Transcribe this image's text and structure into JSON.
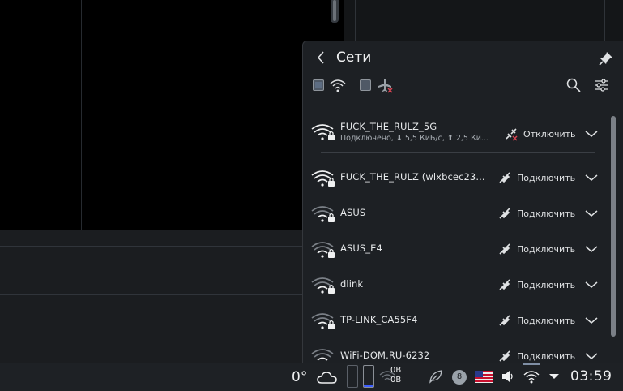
{
  "popup": {
    "title": "Сети",
    "networks": [
      {
        "ssid": "FUCK_THE_RULZ_5G",
        "status": "Подключено, ⬇ 5,5 КиБ/с, ⬆ 2,5 Ки...",
        "action": "Отключить",
        "connected": true
      },
      {
        "ssid": "FUCK_THE_RULZ (wlxbcec23...",
        "action": "Подключить"
      },
      {
        "ssid": "ASUS",
        "action": "Подключить"
      },
      {
        "ssid": "ASUS_E4",
        "action": "Подключить"
      },
      {
        "ssid": "dlink",
        "action": "Подключить"
      },
      {
        "ssid": "TP-LINK_CA55F4",
        "action": "Подключить"
      },
      {
        "ssid": "WiFi-DOM.RU-6232",
        "action": "Подключить"
      }
    ]
  },
  "taskbar": {
    "temperature": "0°",
    "net_down": "0B",
    "net_up": "0B",
    "notifications_count": "8",
    "clock": "03:59"
  },
  "colors": {
    "popup_bg": "#1d2024",
    "taskbar_bg": "#1e2125",
    "accent": "#3d5eff",
    "disconnect_x": "#da4453"
  },
  "icons": [
    "back-arrow-icon",
    "pin-icon",
    "wifi-icon",
    "airplane-off-icon",
    "search-icon",
    "filter-icon",
    "wifi-lock-icon",
    "disconnect-icon",
    "connect-icon",
    "chevron-down-icon",
    "weather-cloud-icon",
    "leaf-icon",
    "flag-us-icon",
    "volume-icon",
    "tray-expand-icon"
  ]
}
